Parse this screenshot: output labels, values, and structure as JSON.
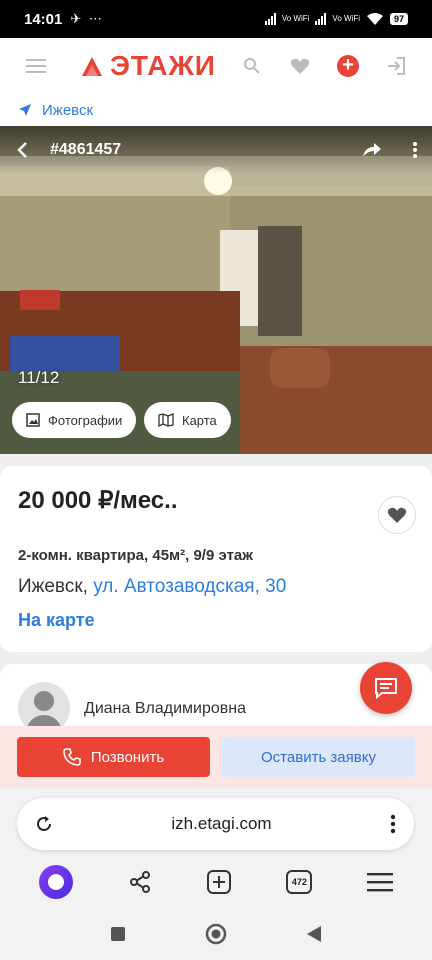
{
  "status_bar": {
    "time": "14:01",
    "extra_icons": "✈ ⋯",
    "volte1": "Vo WiFi",
    "volte2": "Vo WiFi",
    "battery": "97"
  },
  "app": {
    "logo_text": "ЭТАЖИ",
    "brand_color": "#e94335",
    "link_color": "#2d7de0",
    "city": "Ижевск"
  },
  "gallery": {
    "listing_id": "#4861457",
    "counter": "11/12",
    "photos_button": "Фотографии",
    "map_button": "Карта"
  },
  "listing": {
    "price": "20 000 ₽/мес..",
    "details": "2-комн. квартира, 45м², 9/9 этаж",
    "city": "Ижевск,",
    "street": "ул. Автозаводская, 30",
    "on_map": "На карте"
  },
  "agent": {
    "name": "Диана Владимировна"
  },
  "actions": {
    "call": "Позвонить",
    "request": "Оставить заявку"
  },
  "browser": {
    "url": "izh.etagi.com",
    "tabs_count": "472"
  }
}
